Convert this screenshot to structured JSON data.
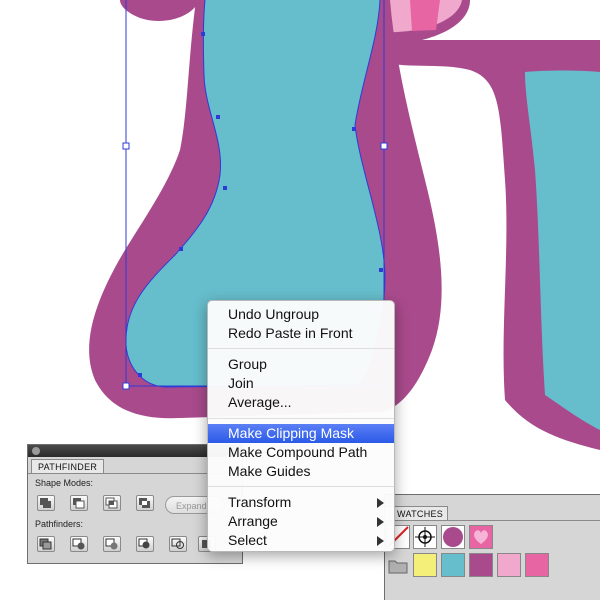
{
  "colors": {
    "outline_purple": "#a94a8c",
    "leg_teal": "#66bdcb",
    "pink_light": "#f0a9cd",
    "pink_mid": "#e865a3",
    "selection_blue": "#2f3bd6",
    "menu_highlight": "#2a5ae8"
  },
  "context_menu": {
    "items": [
      {
        "label": "Undo Ungroup"
      },
      {
        "label": "Redo Paste in Front"
      },
      {
        "label": "Group"
      },
      {
        "label": "Join"
      },
      {
        "label": "Average..."
      },
      {
        "label": "Make Clipping Mask",
        "highlighted": true
      },
      {
        "label": "Make Compound Path"
      },
      {
        "label": "Make Guides"
      },
      {
        "label": "Transform",
        "submenu": true
      },
      {
        "label": "Arrange",
        "submenu": true
      },
      {
        "label": "Select",
        "submenu": true
      }
    ]
  },
  "pathfinder": {
    "tab_label": "PATHFINDER",
    "shape_modes_label": "Shape Modes:",
    "pathfinders_label": "Pathfinders:",
    "expand_label": "Expand",
    "shape_mode_buttons": [
      "unite-icon",
      "minus-front-icon",
      "intersect-icon",
      "exclude-icon"
    ],
    "pathfinder_buttons": [
      "divide-icon",
      "trim-icon",
      "merge-icon",
      "crop-icon",
      "outline-icon",
      "minus-back-icon"
    ]
  },
  "swatches": {
    "tab_label": "WATCHES",
    "row1": [
      {
        "name": "none-swatch-icon",
        "color": "#ffffff"
      },
      {
        "name": "registration-swatch-icon",
        "color": "#ffffff"
      },
      {
        "name": "purple-swatch",
        "color": "#a94a8c"
      },
      {
        "name": "pink-heart-swatch",
        "color": "#e865a3"
      }
    ],
    "row2": [
      {
        "name": "folder-icon",
        "color": "#b8b8b8"
      },
      {
        "name": "yellow-swatch",
        "color": "#f3ef78"
      },
      {
        "name": "teal-swatch",
        "color": "#66bdcb"
      },
      {
        "name": "purple-swatch",
        "color": "#a94a8c"
      },
      {
        "name": "light-pink-swatch",
        "color": "#f0a9cd"
      },
      {
        "name": "pink-swatch",
        "color": "#e865a3"
      }
    ]
  }
}
